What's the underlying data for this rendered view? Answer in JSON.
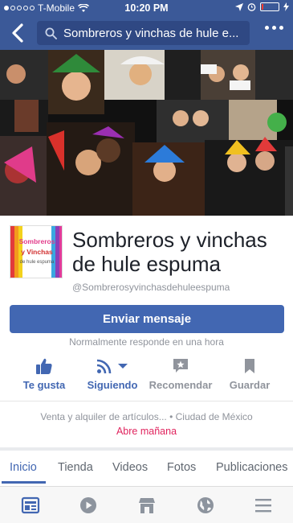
{
  "status_bar": {
    "carrier": "T-Mobile",
    "time": "10:20 PM",
    "signal_bars_filled": 1,
    "battery_level": 0.1
  },
  "nav": {
    "search_text": "Sombreros y vinchas de hule e..."
  },
  "page": {
    "name": "Sombreros y vinchas de hule espuma",
    "handle": "@Sombrerosyvinchasdehuleespuma",
    "logo_text": "Sombreros y Vinchas",
    "logo_tagline": "de hule espuma"
  },
  "message_button": {
    "label": "Enviar mensaje"
  },
  "response_time": "Normalmente responde en una hora",
  "actions": {
    "like": "Te gusta",
    "follow": "Siguiendo",
    "recommend": "Recomendar",
    "save": "Guardar"
  },
  "info": {
    "summary": "Venta y alquiler de artículos... • Ciudad de México",
    "hours": "Abre mañana"
  },
  "tabs": [
    "Inicio",
    "Tienda",
    "Videos",
    "Fotos",
    "Publicaciones"
  ],
  "colors": {
    "facebook_blue": "#3b5998",
    "button_blue": "#4267b2",
    "open_red": "#e0245e",
    "muted_gray": "#90949c"
  },
  "bottom_nav": [
    "news-feed-icon",
    "video-play-icon",
    "marketplace-icon",
    "globe-icon",
    "menu-icon"
  ]
}
